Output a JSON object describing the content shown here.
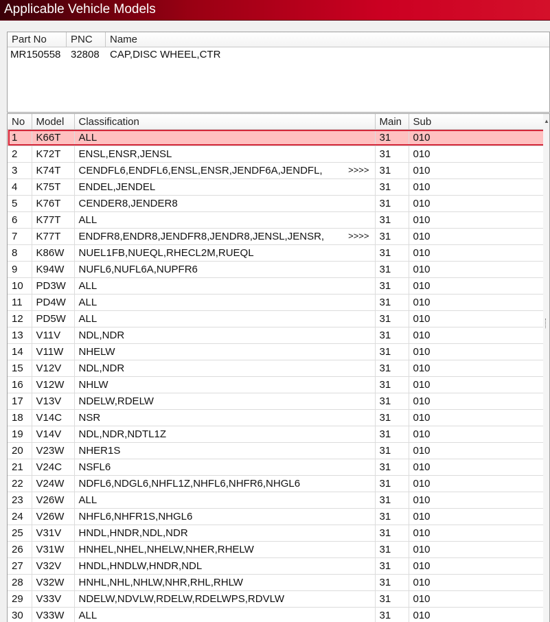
{
  "window": {
    "title": "Applicable Vehicle Models"
  },
  "part": {
    "headers": {
      "part_no": "Part No",
      "pnc": "PNC",
      "name": "Name"
    },
    "values": {
      "part_no": "MR150558",
      "pnc": "32808",
      "name": "CAP,DISC WHEEL,CTR"
    }
  },
  "table": {
    "headers": {
      "no": "No",
      "model": "Model",
      "classification": "Classification",
      "main": "Main",
      "sub": "Sub"
    },
    "more_marker": ">>>>",
    "selected_index": 0,
    "rows": [
      {
        "no": "1",
        "model": "K66T",
        "classification": "ALL",
        "more": false,
        "main": "31",
        "sub": "010"
      },
      {
        "no": "2",
        "model": "K72T",
        "classification": "ENSL,ENSR,JENSL",
        "more": false,
        "main": "31",
        "sub": "010"
      },
      {
        "no": "3",
        "model": "K74T",
        "classification": "CENDFL6,ENDFL6,ENSL,ENSR,JENDF6A,JENDFL,",
        "more": true,
        "main": "31",
        "sub": "010"
      },
      {
        "no": "4",
        "model": "K75T",
        "classification": "ENDEL,JENDEL",
        "more": false,
        "main": "31",
        "sub": "010"
      },
      {
        "no": "5",
        "model": "K76T",
        "classification": "CENDER8,JENDER8",
        "more": false,
        "main": "31",
        "sub": "010"
      },
      {
        "no": "6",
        "model": "K77T",
        "classification": "ALL",
        "more": false,
        "main": "31",
        "sub": "010"
      },
      {
        "no": "7",
        "model": "K77T",
        "classification": "ENDFR8,ENDR8,JENDFR8,JENDR8,JENSL,JENSR,",
        "more": true,
        "main": "31",
        "sub": "010"
      },
      {
        "no": "8",
        "model": "K86W",
        "classification": "NUEL1FB,NUEQL,RHECL2M,RUEQL",
        "more": false,
        "main": "31",
        "sub": "010"
      },
      {
        "no": "9",
        "model": "K94W",
        "classification": "NUFL6,NUFL6A,NUPFR6",
        "more": false,
        "main": "31",
        "sub": "010"
      },
      {
        "no": "10",
        "model": "PD3W",
        "classification": "ALL",
        "more": false,
        "main": "31",
        "sub": "010"
      },
      {
        "no": "11",
        "model": "PD4W",
        "classification": "ALL",
        "more": false,
        "main": "31",
        "sub": "010"
      },
      {
        "no": "12",
        "model": "PD5W",
        "classification": "ALL",
        "more": false,
        "main": "31",
        "sub": "010"
      },
      {
        "no": "13",
        "model": "V11V",
        "classification": "NDL,NDR",
        "more": false,
        "main": "31",
        "sub": "010"
      },
      {
        "no": "14",
        "model": "V11W",
        "classification": "NHELW",
        "more": false,
        "main": "31",
        "sub": "010"
      },
      {
        "no": "15",
        "model": "V12V",
        "classification": "NDL,NDR",
        "more": false,
        "main": "31",
        "sub": "010"
      },
      {
        "no": "16",
        "model": "V12W",
        "classification": "NHLW",
        "more": false,
        "main": "31",
        "sub": "010"
      },
      {
        "no": "17",
        "model": "V13V",
        "classification": "NDELW,RDELW",
        "more": false,
        "main": "31",
        "sub": "010"
      },
      {
        "no": "18",
        "model": "V14C",
        "classification": "NSR",
        "more": false,
        "main": "31",
        "sub": "010"
      },
      {
        "no": "19",
        "model": "V14V",
        "classification": "NDL,NDR,NDTL1Z",
        "more": false,
        "main": "31",
        "sub": "010"
      },
      {
        "no": "20",
        "model": "V23W",
        "classification": "NHER1S",
        "more": false,
        "main": "31",
        "sub": "010"
      },
      {
        "no": "21",
        "model": "V24C",
        "classification": "NSFL6",
        "more": false,
        "main": "31",
        "sub": "010"
      },
      {
        "no": "22",
        "model": "V24W",
        "classification": "NDFL6,NDGL6,NHFL1Z,NHFL6,NHFR6,NHGL6",
        "more": false,
        "main": "31",
        "sub": "010"
      },
      {
        "no": "23",
        "model": "V26W",
        "classification": "ALL",
        "more": false,
        "main": "31",
        "sub": "010"
      },
      {
        "no": "24",
        "model": "V26W",
        "classification": "NHFL6,NHFR1S,NHGL6",
        "more": false,
        "main": "31",
        "sub": "010"
      },
      {
        "no": "25",
        "model": "V31V",
        "classification": "HNDL,HNDR,NDL,NDR",
        "more": false,
        "main": "31",
        "sub": "010"
      },
      {
        "no": "26",
        "model": "V31W",
        "classification": "HNHEL,NHEL,NHELW,NHER,RHELW",
        "more": false,
        "main": "31",
        "sub": "010"
      },
      {
        "no": "27",
        "model": "V32V",
        "classification": "HNDL,HNDLW,HNDR,NDL",
        "more": false,
        "main": "31",
        "sub": "010"
      },
      {
        "no": "28",
        "model": "V32W",
        "classification": "HNHL,NHL,NHLW,NHR,RHL,RHLW",
        "more": false,
        "main": "31",
        "sub": "010"
      },
      {
        "no": "29",
        "model": "V33V",
        "classification": "NDELW,NDVLW,RDELW,RDELWPS,RDVLW",
        "more": false,
        "main": "31",
        "sub": "010"
      },
      {
        "no": "30",
        "model": "V33W",
        "classification": "ALL",
        "more": false,
        "main": "31",
        "sub": "010"
      }
    ]
  }
}
